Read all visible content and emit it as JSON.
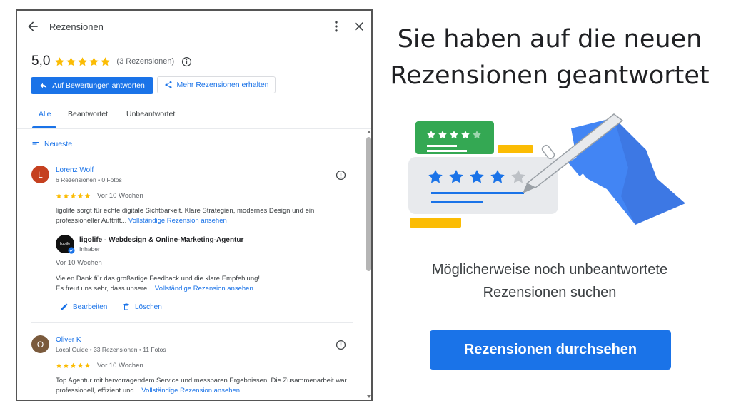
{
  "panel": {
    "title": "Rezensionen",
    "rating_value": "5,0",
    "rating_count": "(3 Rezensionen)",
    "reply_button_label": "Auf Bewertungen antworten",
    "more_reviews_button_label": "Mehr Rezensionen erhalten",
    "tabs": [
      "Alle",
      "Beantwortet",
      "Unbeantwortet"
    ],
    "active_tab": "Alle",
    "sort_label": "Neueste",
    "reviews": [
      {
        "initial": "L",
        "name": "Lorenz Wolf",
        "meta": "6 Rezensionen • 0 Fotos",
        "stars": 5,
        "date": "Vor 10 Wochen",
        "text": "ligolife sorgt für echte digitale Sichtbarkeit. Klare Strategien, modernes Design und ein professioneller Auftritt...",
        "more_link": "Vollständige Rezension ansehen",
        "avatar_color": "#c5401f"
      },
      {
        "initial": "O",
        "name": "Oliver K",
        "meta": "Local Guide • 33 Rezensionen • 11 Fotos",
        "stars": 5,
        "date": "Vor 10 Wochen",
        "text": "Top Agentur mit hervorragendem Service und messbaren Ergebnissen. Die Zusammenarbeit war professionell, effizient und...",
        "more_link": "Vollständige Rezension ansehen",
        "avatar_color": "#7a5a3c"
      }
    ],
    "owner_reply": {
      "avatar_text": "ligolife",
      "name": "ligolife - Webdesign & Online-Marketing-Agentur",
      "role": "Inhaber",
      "date": "Vor 10 Wochen",
      "text_line1": "Vielen Dank für das großartige Feedback und die klare Empfehlung!",
      "text_line2": "Es freut uns sehr, dass unsere...",
      "more_link": "Vollständige Rezension ansehen",
      "edit_label": "Bearbeiten",
      "delete_label": "Löschen"
    }
  },
  "promo": {
    "heading": "Sie haben auf die neuen Rezensionen geantwortet",
    "subtext": "Möglicherweise noch unbeantwortete Rezensionen suchen",
    "cta_label": "Rezensionen durchsehen"
  },
  "colors": {
    "accent": "#1a73e8",
    "star": "#fbbc04",
    "green": "#34a853"
  },
  "icons": [
    "back-arrow-icon",
    "more-vert-icon",
    "close-icon",
    "info-icon",
    "reply-icon",
    "share-icon",
    "sort-icon",
    "flag-icon",
    "verified-icon",
    "edit-icon",
    "delete-icon"
  ]
}
